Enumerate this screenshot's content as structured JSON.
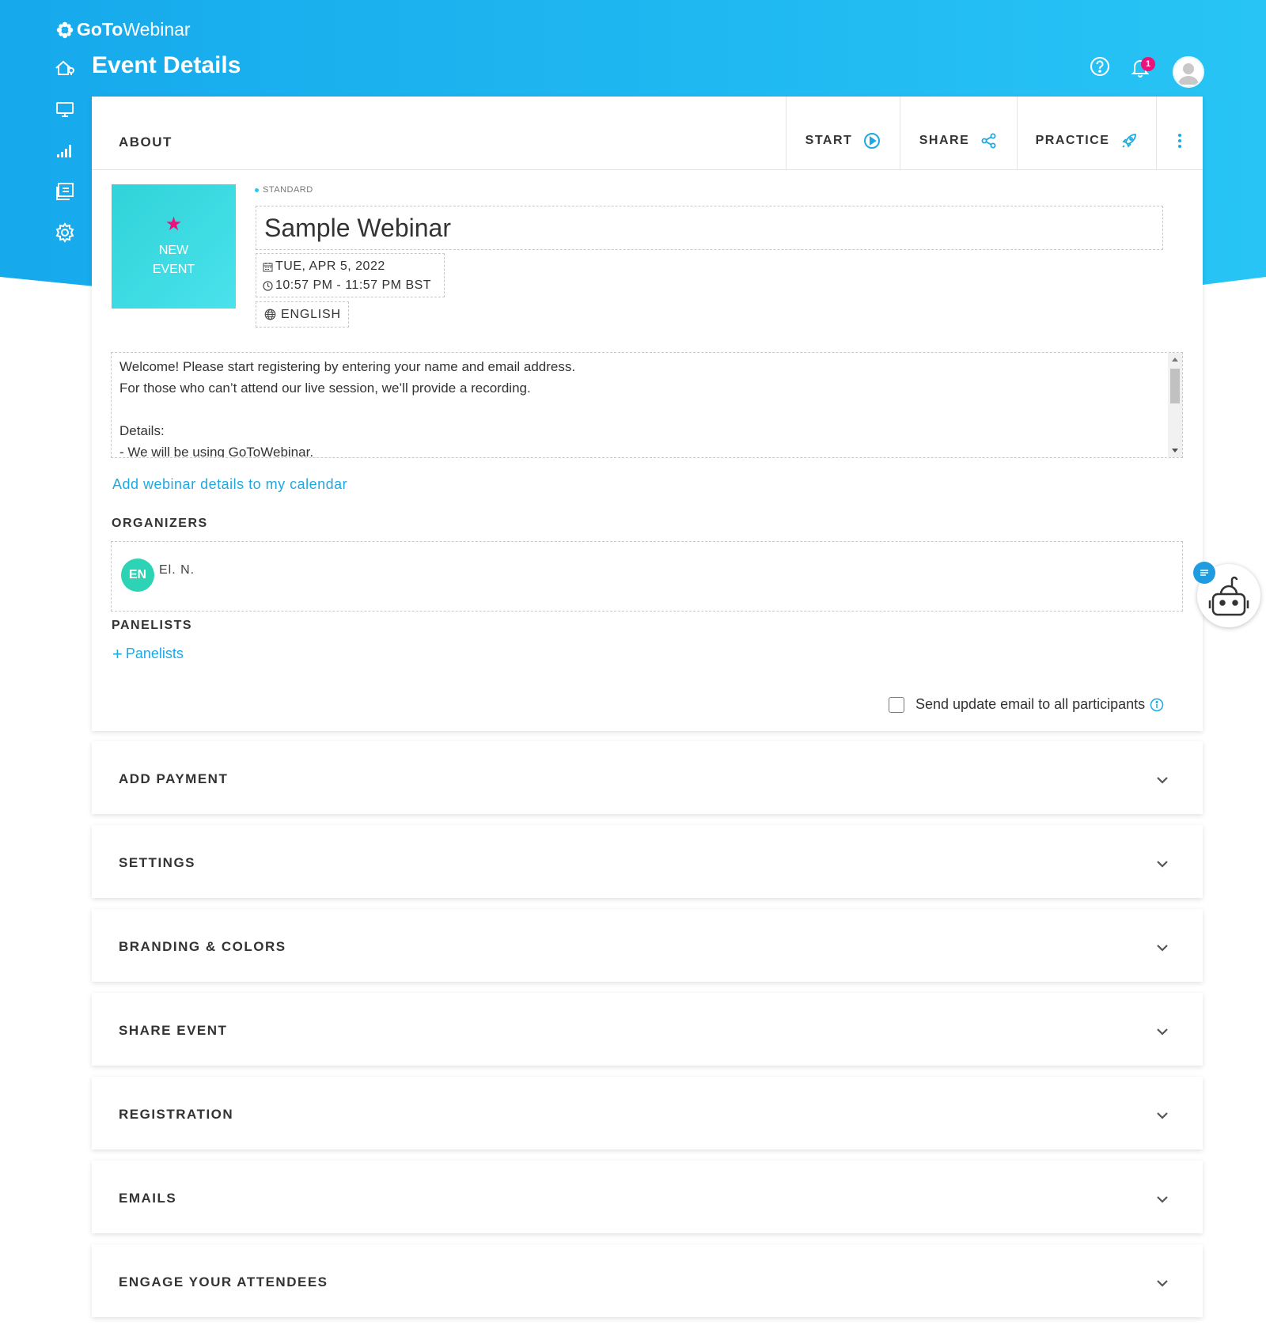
{
  "app": {
    "logo_bold": "GoTo",
    "logo_rest": "Webinar"
  },
  "header": {
    "page_title": "Event Details",
    "notification_count": "1"
  },
  "nav": {
    "items": [
      "home-icon",
      "monitor-icon",
      "analytics-icon",
      "recordings-icon",
      "settings-icon"
    ]
  },
  "about": {
    "title": "ABOUT",
    "actions": {
      "start": "START",
      "share": "SHARE",
      "practice": "PRACTICE"
    },
    "thumbnail": {
      "line1": "NEW",
      "line2": "EVENT"
    },
    "type": "STANDARD",
    "webinar_title": "Sample Webinar",
    "date": "TUE, APR 5, 2022",
    "time": "10:57 PM - 11:57 PM BST",
    "language": "ENGLISH",
    "description": "Welcome! Please start registering by entering your name and email address.\nFor those who can’t attend our live session, we’ll provide a recording.\n\nDetails:\n- We will be using GoToWebinar.",
    "calendar_link": "Add webinar details to my calendar",
    "organizers_label": "ORGANIZERS",
    "organizer": {
      "initials": "EN",
      "name": "El. N."
    },
    "panelists_label": "PANELISTS",
    "panelists_link": "Panelists",
    "send_update_label": "Send update email to all participants"
  },
  "sections": [
    {
      "title": "ADD PAYMENT"
    },
    {
      "title": "SETTINGS"
    },
    {
      "title": "BRANDING & COLORS"
    },
    {
      "title": "SHARE EVENT"
    },
    {
      "title": "REGISTRATION"
    },
    {
      "title": "EMAILS"
    },
    {
      "title": "ENGAGE YOUR ATTENDEES"
    }
  ],
  "colors": {
    "brand_blue": "#27c4f5",
    "link_blue": "#1fa9e1",
    "badge_pink": "#e8147a",
    "avatar_teal": "#2cd3b4"
  }
}
